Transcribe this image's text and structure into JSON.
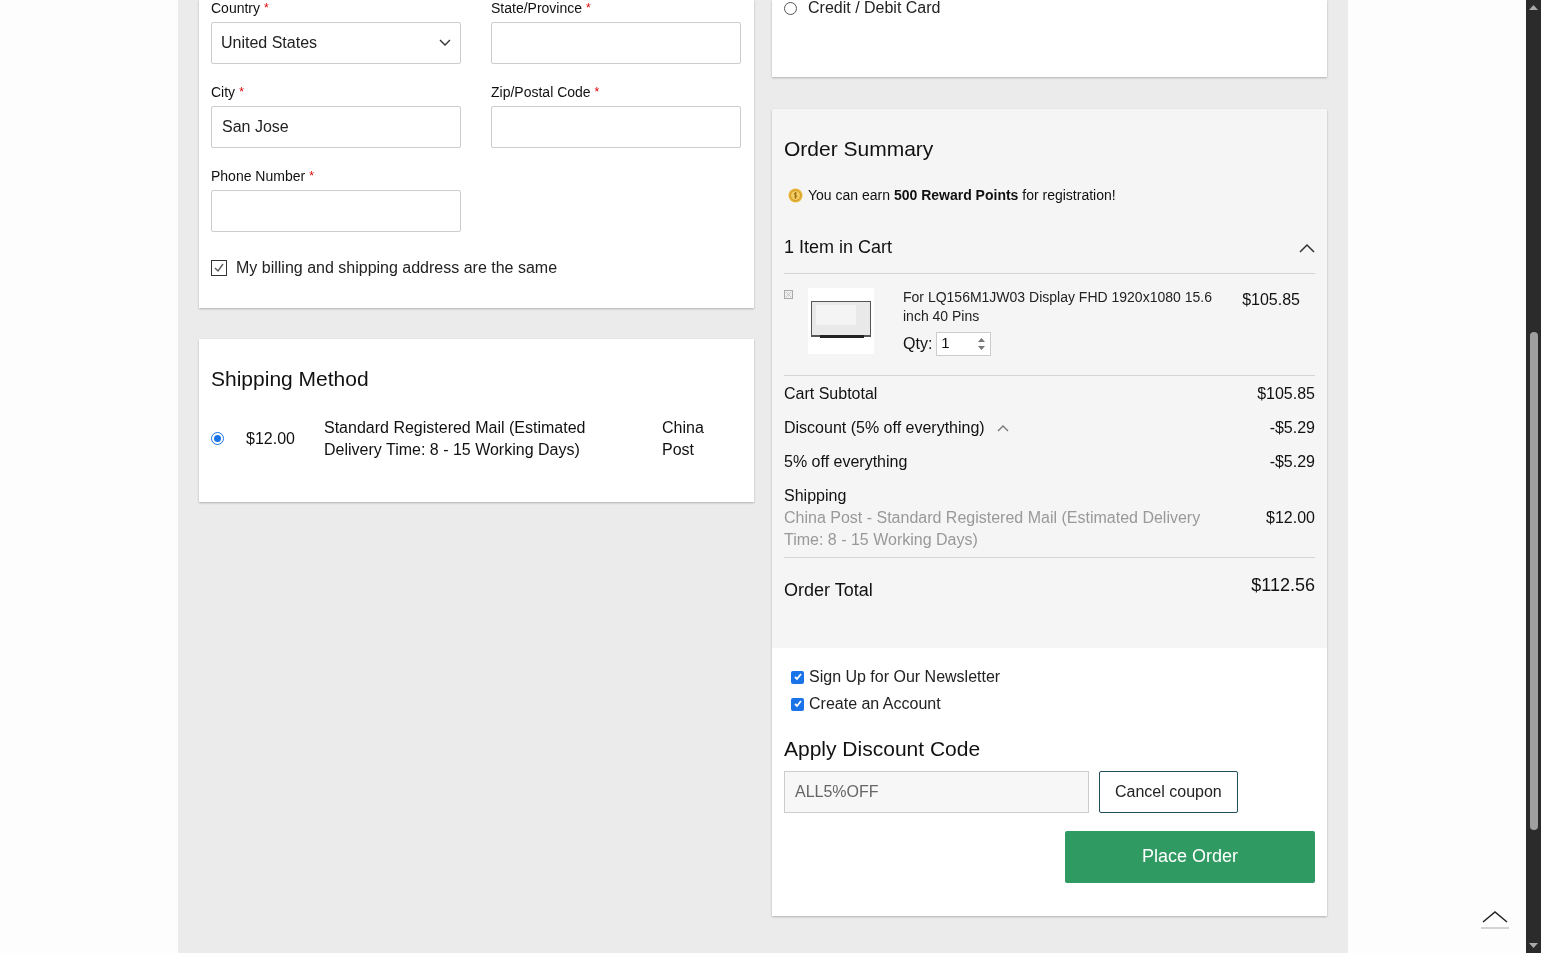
{
  "address_form": {
    "fields": [
      {
        "label": "Country",
        "required_mark": "*",
        "kind": "select",
        "value": "United States"
      },
      {
        "label": "State/Province",
        "required_mark": "*",
        "kind": "text"
      },
      {
        "label": "City",
        "required_mark": "*",
        "kind": "text",
        "value": "San Jose"
      },
      {
        "label": "Zip/Postal Code",
        "required_mark": "*",
        "kind": "text"
      },
      {
        "label": "Phone Number",
        "required_mark": "*",
        "kind": "text"
      }
    ],
    "same_address": {
      "label": "My billing and shipping address are the same",
      "checked": true
    }
  },
  "shipping_method": {
    "title": "Shipping Method",
    "options": [
      {
        "price": "$12.00",
        "method": "Standard Registered Mail (Estimated Delivery Time: 8 - 15 Working Days)",
        "carrier": "China Post",
        "selected": true
      }
    ]
  },
  "payment_methods": [
    {
      "label": "Credit / Debit Card",
      "selected": false
    }
  ],
  "order_summary": {
    "title": "Order Summary",
    "reward": "You can earn **500 Reward Points** for registration!",
    "cart_header": "1 Item in Cart",
    "cart_expanded": true,
    "items": [
      {
        "name": "For LQ156M1JW03 Display FHD 1920x1080 15.6 inch 40 Pins",
        "price": "$105.85",
        "qty_label": "Qty:",
        "qty": "1"
      }
    ],
    "totals": [
      {
        "kind": "line",
        "label": "Cart Subtotal",
        "amount": "$105.85"
      },
      {
        "kind": "toggle",
        "label": "Discount (5% off everything)",
        "amount": "-$5.29",
        "expanded": true
      },
      {
        "kind": "line",
        "label": "5% off everything",
        "amount": "-$5.29"
      },
      {
        "kind": "shipping",
        "label": "Shipping",
        "detail": "China Post - Standard Registered Mail (Estimated Delivery Time: 8 - 15 Working Days)",
        "amount": "$12.00"
      }
    ],
    "order_total": {
      "label": "Order Total",
      "amount": "$112.56"
    }
  },
  "options": [
    {
      "label": "Sign Up for Our Newsletter",
      "checked": true
    },
    {
      "label": "Create an Account",
      "checked": true
    }
  ],
  "discount": {
    "title": "Apply Discount Code",
    "value": "ALL5%OFF",
    "button": "Cancel coupon"
  },
  "place_order": "Place Order"
}
